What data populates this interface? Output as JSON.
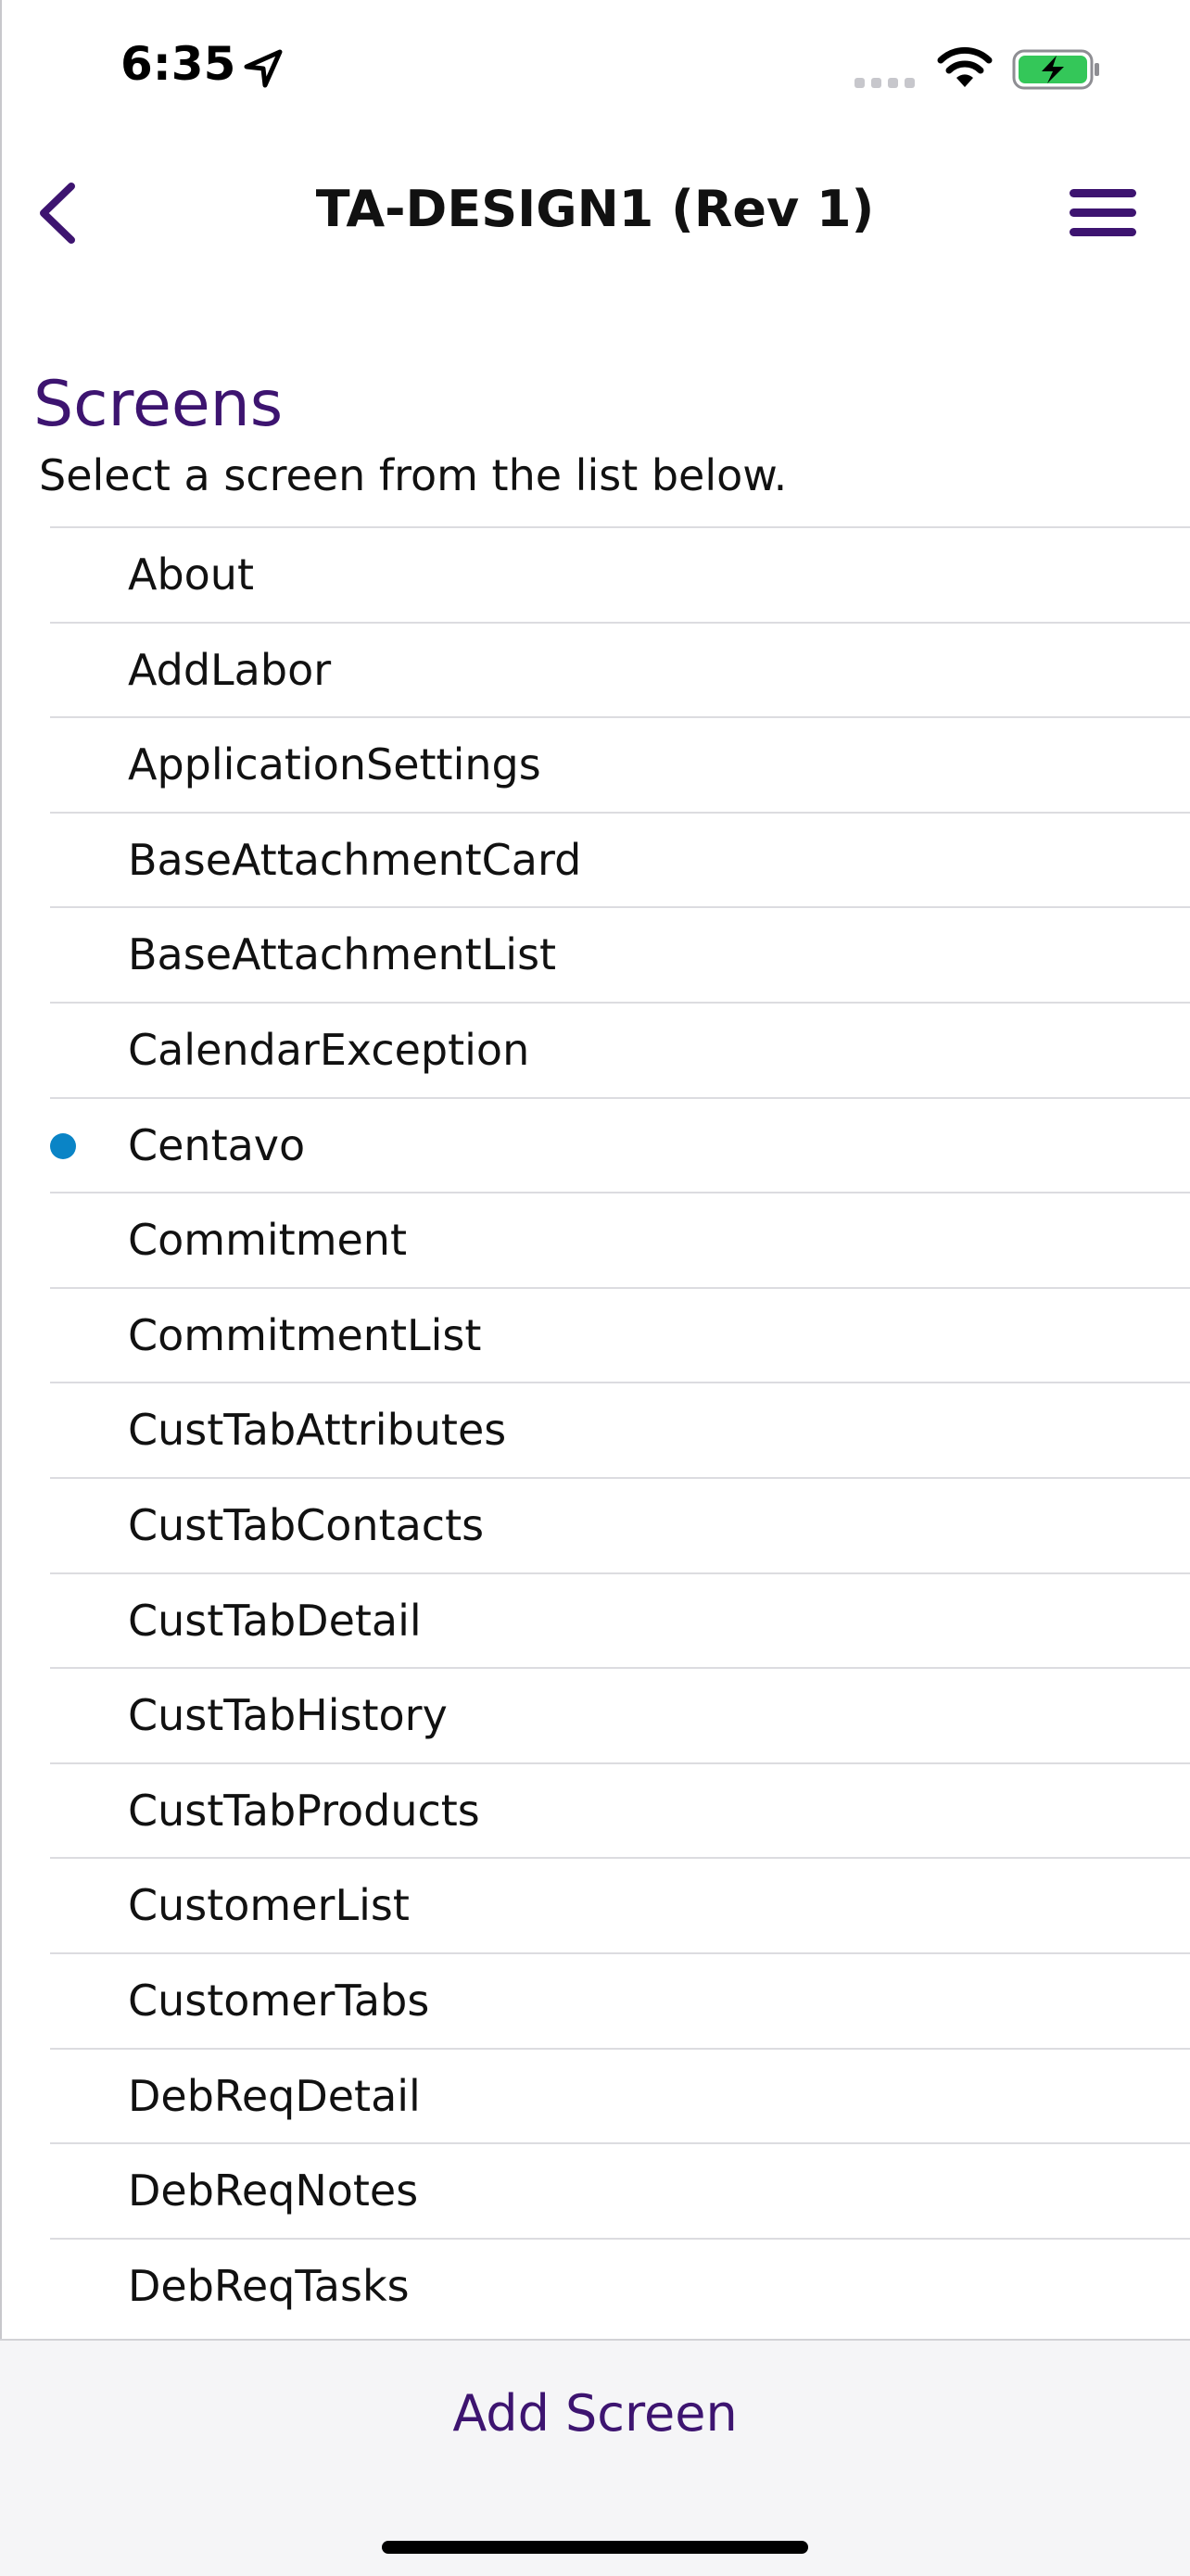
{
  "status_bar": {
    "time": "6:35",
    "location_icon": "location-arrow-icon",
    "signal_icon": "cellular-signal-icon",
    "wifi_icon": "wifi-icon",
    "battery_icon": "battery-charging-icon",
    "battery_color": "#34c759"
  },
  "nav": {
    "title": "TA-DESIGN1 (Rev 1)",
    "back_icon": "chevron-left-icon",
    "menu_icon": "hamburger-menu-icon",
    "accent_color": "#3d1470"
  },
  "header": {
    "title": "Screens",
    "subtitle": "Select a screen from the list below."
  },
  "screens": [
    {
      "label": "About",
      "selected": false
    },
    {
      "label": "AddLabor",
      "selected": false
    },
    {
      "label": "ApplicationSettings",
      "selected": false
    },
    {
      "label": "BaseAttachmentCard",
      "selected": false
    },
    {
      "label": "BaseAttachmentList",
      "selected": false
    },
    {
      "label": "CalendarException",
      "selected": false
    },
    {
      "label": "Centavo",
      "selected": true
    },
    {
      "label": "Commitment",
      "selected": false
    },
    {
      "label": "CommitmentList",
      "selected": false
    },
    {
      "label": "CustTabAttributes",
      "selected": false
    },
    {
      "label": "CustTabContacts",
      "selected": false
    },
    {
      "label": "CustTabDetail",
      "selected": false
    },
    {
      "label": "CustTabHistory",
      "selected": false
    },
    {
      "label": "CustTabProducts",
      "selected": false
    },
    {
      "label": "CustomerList",
      "selected": false
    },
    {
      "label": "CustomerTabs",
      "selected": false
    },
    {
      "label": "DebReqDetail",
      "selected": false
    },
    {
      "label": "DebReqNotes",
      "selected": false
    },
    {
      "label": "DebReqTasks",
      "selected": false
    }
  ],
  "selected_dot_color": "#0a84c6",
  "footer": {
    "add_button_label": "Add Screen"
  }
}
